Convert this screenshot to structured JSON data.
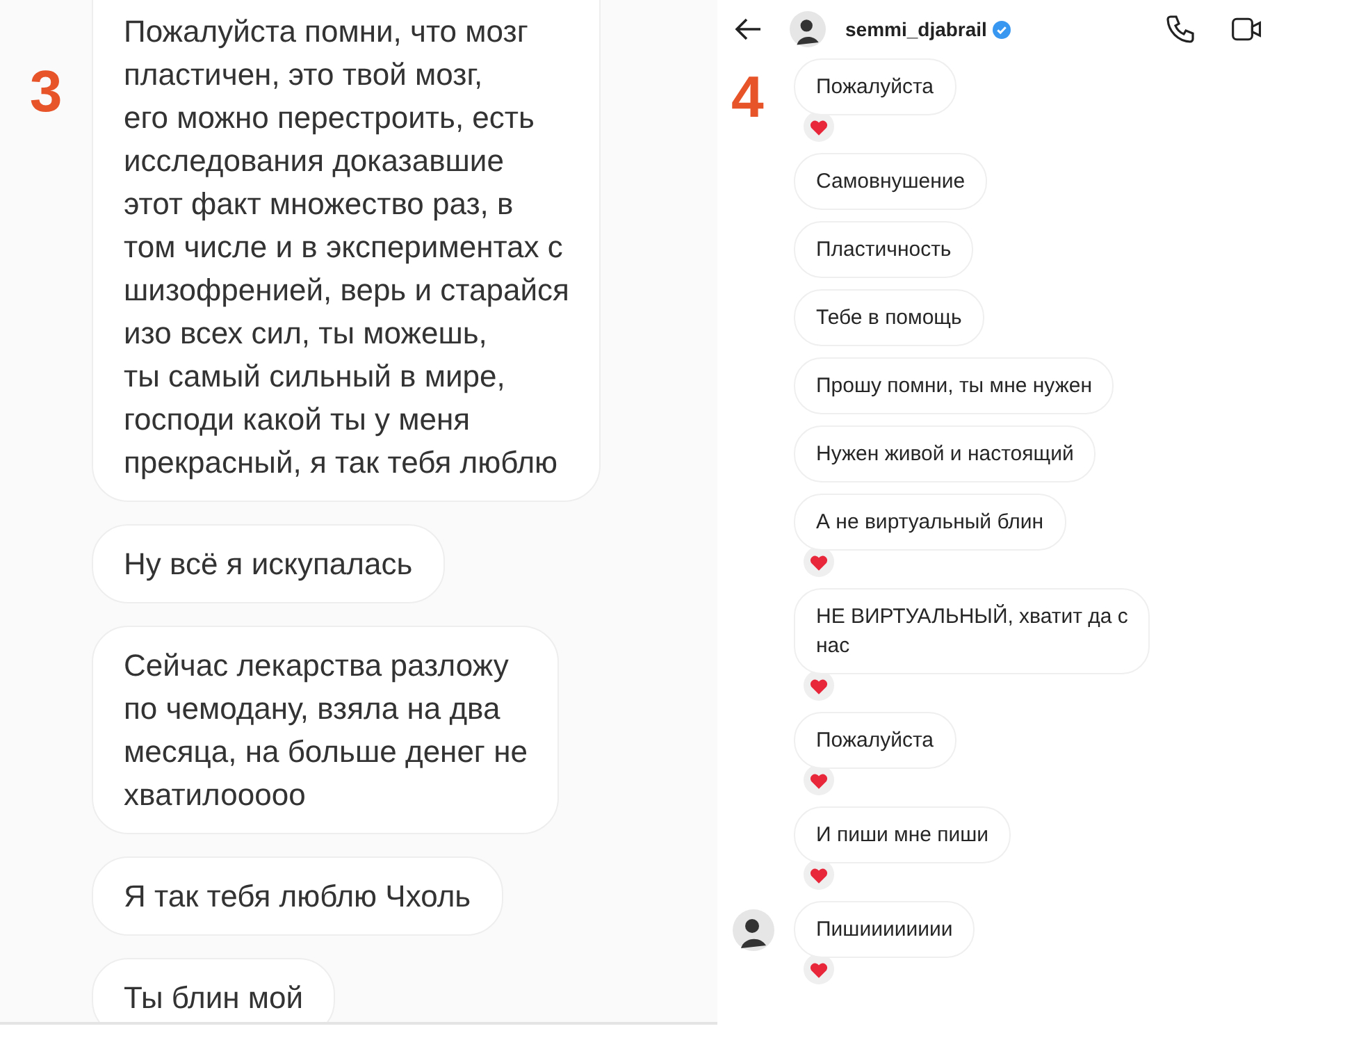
{
  "panels": [
    {
      "number": "3",
      "messages": [
        {
          "text": "Пожалуйста помни, что мозг\nпластичен, это твой мозг,\nего можно перестроить, есть\nисследования доказавшие\nэтот факт множество раз, в\nтом числе и в экспериментах с\nшизофренией, верь и старайся\nизо всех сил, ты можешь,\nты самый сильный в мире,\nгосподи какой ты у меня\nпрекрасный, я так тебя люблю"
        },
        {
          "text": "Ну всё я искупалась"
        },
        {
          "text": "Сейчас лекарства разложу\nпо чемодану, взяла на два\nмесяца, на больше денег не\nхватилооооо"
        },
        {
          "text": "Я так тебя люблю Чхоль"
        },
        {
          "text": "Ты блин мой"
        }
      ]
    },
    {
      "number": "4",
      "header": {
        "username": "semmi_djabrail",
        "verified": true
      },
      "messages": [
        {
          "text": "Пожалуйста",
          "reacted": true,
          "avatar": false
        },
        {
          "text": "Самовнушение",
          "reacted": false,
          "avatar": false
        },
        {
          "text": "Пластичность",
          "reacted": false,
          "avatar": false
        },
        {
          "text": "Тебе в помощь",
          "reacted": false,
          "avatar": false
        },
        {
          "text": "Прошу помни, ты мне нужен",
          "reacted": false,
          "avatar": false
        },
        {
          "text": "Нужен живой и настоящий",
          "reacted": false,
          "avatar": false
        },
        {
          "text": "А не виртуальный блин",
          "reacted": true,
          "avatar": false
        },
        {
          "text": "НЕ ВИРТУАЛЬНЫЙ, хватит да с\nнас",
          "reacted": true,
          "avatar": false
        },
        {
          "text": "Пожалуйста",
          "reacted": true,
          "avatar": false
        },
        {
          "text": "И пиши мне пиши",
          "reacted": true,
          "avatar": false
        },
        {
          "text": "Пишииииииии",
          "reacted": true,
          "avatar": true
        }
      ]
    }
  ]
}
